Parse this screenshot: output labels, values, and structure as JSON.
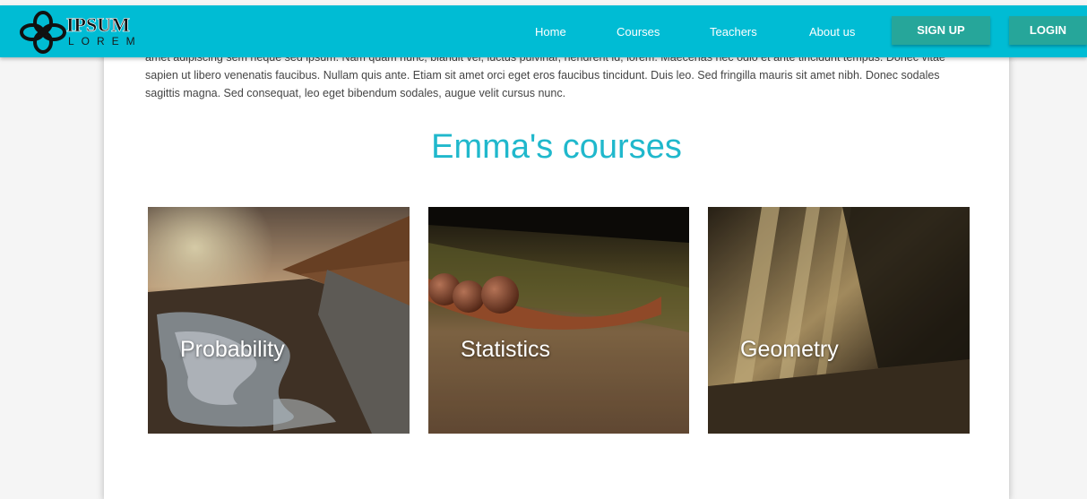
{
  "brand": {
    "name": "IPSUM",
    "subtitle": "LOREM"
  },
  "nav": {
    "links": [
      {
        "label": "Home"
      },
      {
        "label": "Courses"
      },
      {
        "label": "Teachers"
      },
      {
        "label": "About us"
      }
    ],
    "signup_label": "SIGN UP",
    "login_label": "LOGIN"
  },
  "colors": {
    "header_bg": "#00bcd4",
    "accent": "#20b8cc",
    "button_bg": "#26a69a"
  },
  "intro": {
    "text": "amet adipiscing sem neque sed ipsum. Nam quam nunc, blandit vel, luctus pulvinar, hendrerit id, lorem. Maecenas nec odio et ante tincidunt tempus. Donec vitae sapien ut libero venenatis faucibus. Nullam quis ante. Etiam sit amet orci eget eros faucibus tincidunt. Duis leo. Sed fringilla mauris sit amet nibh. Donec sodales sagittis magna. Sed consequat, leo eget bibendum sodales, augue velit cursus nunc."
  },
  "section": {
    "title": "Emma's courses"
  },
  "courses": [
    {
      "label": "Probability"
    },
    {
      "label": "Statistics"
    },
    {
      "label": "Geometry"
    }
  ]
}
